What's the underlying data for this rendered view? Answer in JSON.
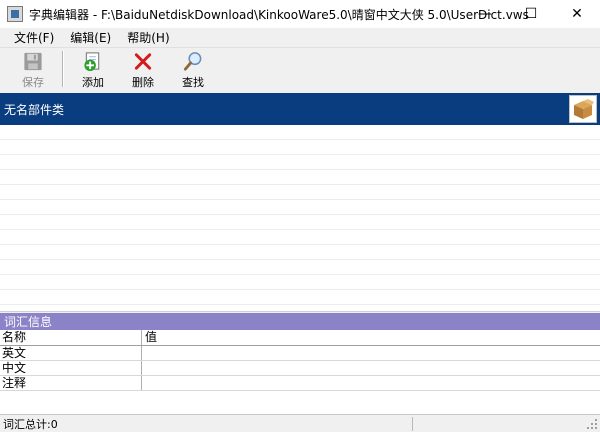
{
  "window": {
    "title": "字典编辑器 - F:\\BaiduNetdiskDownload\\KinkooWare5.0\\晴窗中文大侠 5.0\\UserDict.vws",
    "minimize_glyph": "—",
    "maximize_glyph": "☐",
    "close_glyph": "✕"
  },
  "menu": {
    "items": [
      {
        "label": "文件(F)"
      },
      {
        "label": "编辑(E)"
      },
      {
        "label": "帮助(H)"
      }
    ]
  },
  "toolbar": {
    "save_label": "保存",
    "add_label": "添加",
    "delete_label": "删除",
    "find_label": "查找"
  },
  "category": {
    "title": "无名部件类"
  },
  "info": {
    "title": "词汇信息",
    "columns": [
      "名称",
      "值"
    ],
    "rows": [
      {
        "name": "英文",
        "value": ""
      },
      {
        "name": "中文",
        "value": ""
      },
      {
        "name": "注释",
        "value": ""
      }
    ]
  },
  "status": {
    "text": "词汇总计:0"
  },
  "colors": {
    "category_header": "#0a3d7f",
    "info_header": "#8b82c7"
  }
}
